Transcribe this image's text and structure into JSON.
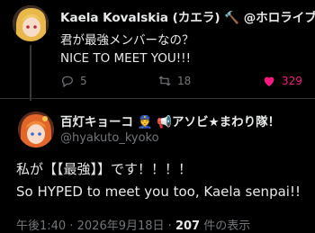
{
  "reply_tweet": {
    "author_name": "Kaela Kovalskia (カエラ) 🔨 @ホロライブ",
    "text_line1": "君が最強メンバーなの？",
    "text_line2": "NICE TO MEET YOU!!!",
    "replies": "5",
    "retweets": "18",
    "likes": "329"
  },
  "main_tweet": {
    "author_name": "百灯キョーコ 👮 📢アソビ★まわり隊！",
    "handle": "@hyakuto_kyoko",
    "text_line1": "私が【【最強】】です！！！！",
    "text_line2": "So HYPED to meet you too, Kaela senpai!!",
    "time": "午後1:40",
    "date": "2026年9月18日",
    "views_count": "207",
    "views_label": "件の表示"
  },
  "colors": {
    "like": "#f91880",
    "muted": "#71767b",
    "text": "#e7e9ea"
  }
}
